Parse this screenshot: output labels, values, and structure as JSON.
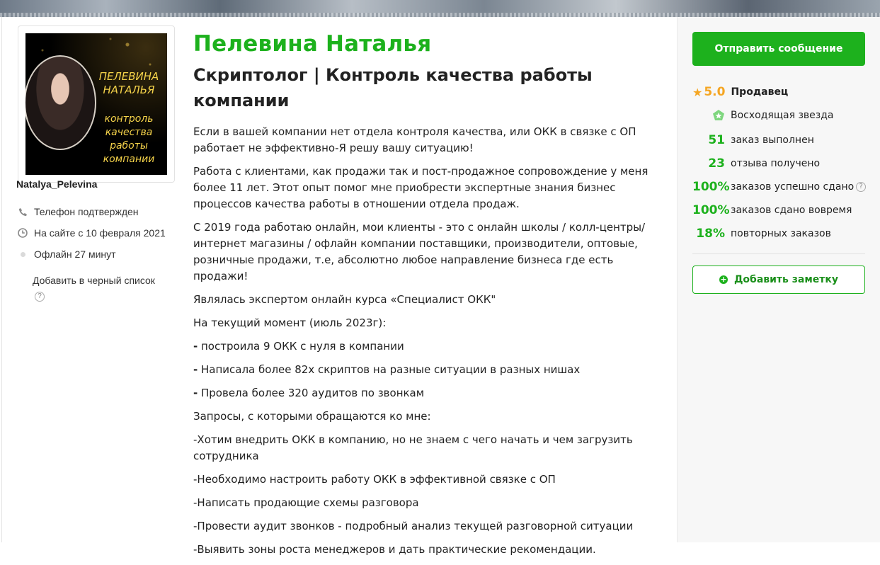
{
  "profile": {
    "avatar_title": "ПЕЛЕВИНА НАТАЛЬЯ",
    "avatar_subtitle": "контроль качества работы компании",
    "username": "Natalya_Pelevina",
    "phone": "Телефон подтвержден",
    "since": "На сайте с 10 февраля 2021",
    "status": "Офлайн 27 минут",
    "blacklist": "Добавить в черный список"
  },
  "main": {
    "name": "Пелевина Наталья",
    "headline": "Скриптолог | Контроль качества работы компании",
    "paragraphs": [
      "Если в вашей компании нет отдела контроля качества, или ОКК в связке с ОП работает не эффективно-Я решу вашу ситуацию!",
      "Работа с клиентами, как продажи так и пост-продажное сопровождение у меня более 11 лет. Этот опыт помог мне приобрести экспертные знания бизнес процессов качества работы в отношении отдела продаж.",
      "С 2019 года работаю онлайн, мои клиенты - это с онлайн школы / колл-центры/ интернет магазины / офлайн компании поставщики, производители, оптовые, розничные продажи, т.е, абсолютно любое направление бизнеса где есть продажи!",
      "Являлась экспертом онлайн курса «Специалист ОКК\"",
      "На текущий момент (июль 2023г):"
    ],
    "bullet_mark": "-",
    "bullets": [
      " построила 9 ОКК с нуля в компании",
      " Написала более 82х скриптов на разные ситуации в разных нишах",
      " Провела более 320 аудитов по звонкам"
    ],
    "requests_title": "Запросы, с которыми обращаются ко мне:",
    "requests": [
      "-Хотим внедрить ОКК в компанию, но не знаем с чего начать и чем загрузить сотрудника",
      "-Необходимо настроить работу ОКК в эффективной связке с ОП",
      "-Написать продающие схемы разговора",
      "-Провести аудит звонков - подробный анализ текущей разговорной ситуации",
      "-Выявить зоны роста менеджеров и дать практические рекомендации."
    ]
  },
  "sidebar": {
    "message_button": "Отправить сообщение",
    "rating_value": "5.0",
    "rating_role": "Продавец",
    "badge": "Восходящая звезда",
    "stats": [
      {
        "num": "51",
        "label": "заказ выполнен"
      },
      {
        "num": "23",
        "label": "отзыва получено"
      },
      {
        "num": "100%",
        "label": "заказов успешно сдано"
      },
      {
        "num": "100%",
        "label": "заказов сдано вовремя"
      },
      {
        "num": "18%",
        "label": "повторных заказов"
      }
    ],
    "note_button": "Добавить заметку"
  },
  "colors": {
    "accent": "#1db11d",
    "star": "#f5a623"
  }
}
